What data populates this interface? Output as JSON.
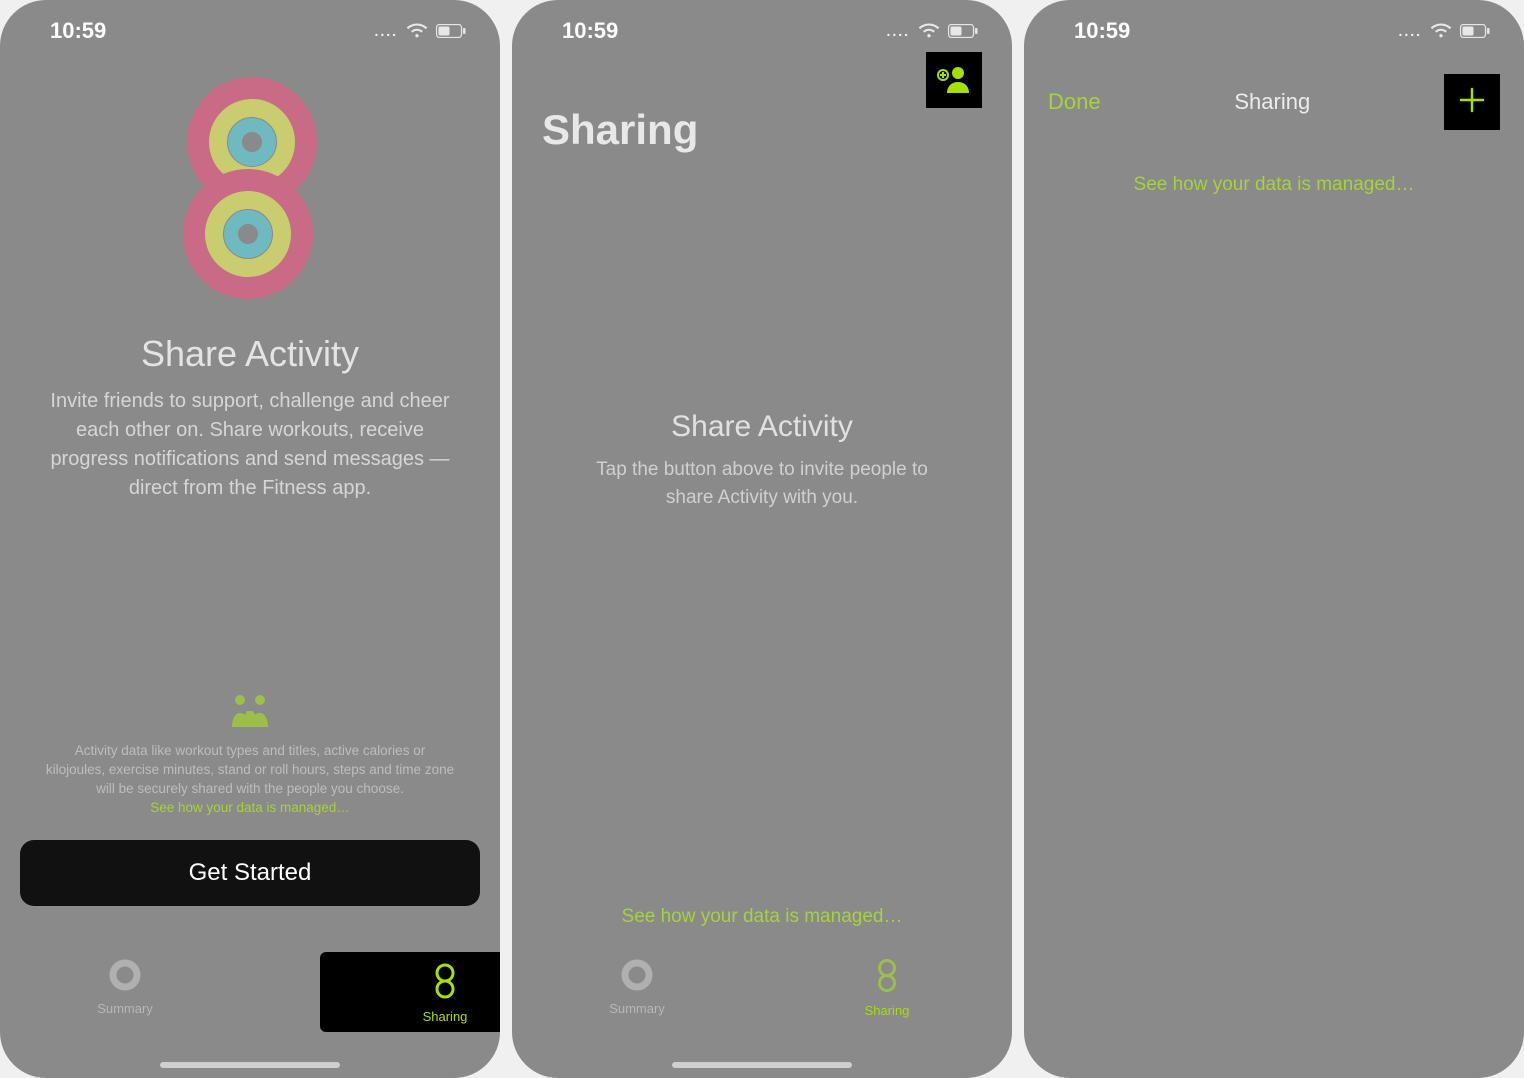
{
  "status": {
    "time": "10:59"
  },
  "screen1": {
    "title": "Share Activity",
    "description": "Invite friends to support, challenge and cheer each other on. Share workouts, receive progress notifications and send messages — direct from the Fitness app.",
    "footnote": "Activity data like workout types and titles, active calories or kilojoules, exercise minutes, stand or roll hours, steps and time zone will be securely shared with the people you choose.",
    "footnote_link": "See how your data is managed…",
    "cta": "Get Started",
    "tabs": {
      "summary": "Summary",
      "sharing": "Sharing"
    }
  },
  "screen2": {
    "heading": "Sharing",
    "title": "Share Activity",
    "description": "Tap the button above to invite people to share Activity with you.",
    "link": "See how your data is managed…",
    "tabs": {
      "summary": "Summary",
      "sharing": "Sharing"
    }
  },
  "screen3": {
    "done": "Done",
    "title": "Sharing",
    "link": "See how your data is managed…"
  },
  "colors": {
    "accent": "#a4e000"
  }
}
